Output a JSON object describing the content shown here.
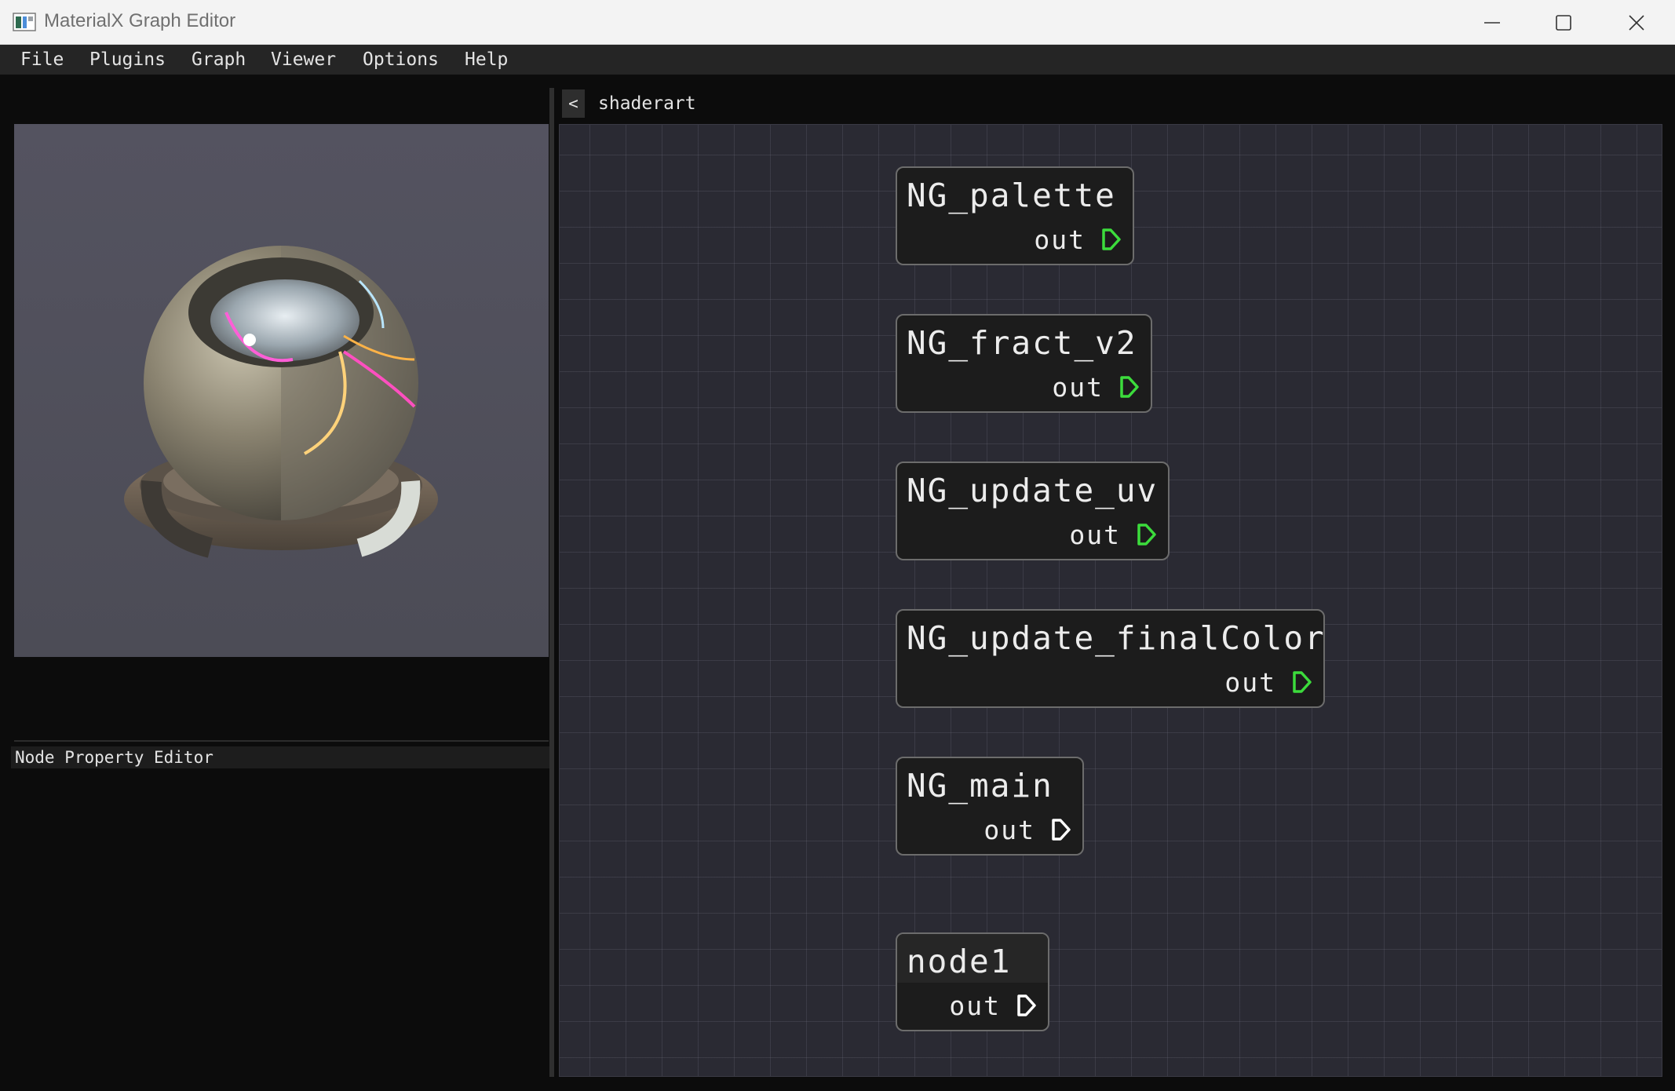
{
  "window": {
    "title": "MaterialX Graph Editor"
  },
  "menu": [
    "File",
    "Plugins",
    "Graph",
    "Viewer",
    "Options",
    "Help"
  ],
  "left_panel": {
    "property_editor_title": "Node Property Editor"
  },
  "graph": {
    "back_label": "<",
    "title": "shaderart",
    "nodes": [
      {
        "name": "NG_palette",
        "output": "out",
        "pin_color": "#3cdc3c"
      },
      {
        "name": "NG_fract_v2",
        "output": "out",
        "pin_color": "#3cdc3c"
      },
      {
        "name": "NG_update_uv",
        "output": "out",
        "pin_color": "#3cdc3c"
      },
      {
        "name": "NG_update_finalColor",
        "output": "out",
        "pin_color": "#3cdc3c"
      },
      {
        "name": "NG_main",
        "output": "out",
        "pin_color": "#ffffff"
      },
      {
        "name": "node1",
        "output": "out",
        "pin_color": "#ffffff"
      }
    ]
  },
  "colors": {
    "canvas_bg": "#2a2a33",
    "node_bg": "#1c1c1c",
    "pin_float3": "#3cdc3c",
    "pin_generic": "#ffffff"
  }
}
